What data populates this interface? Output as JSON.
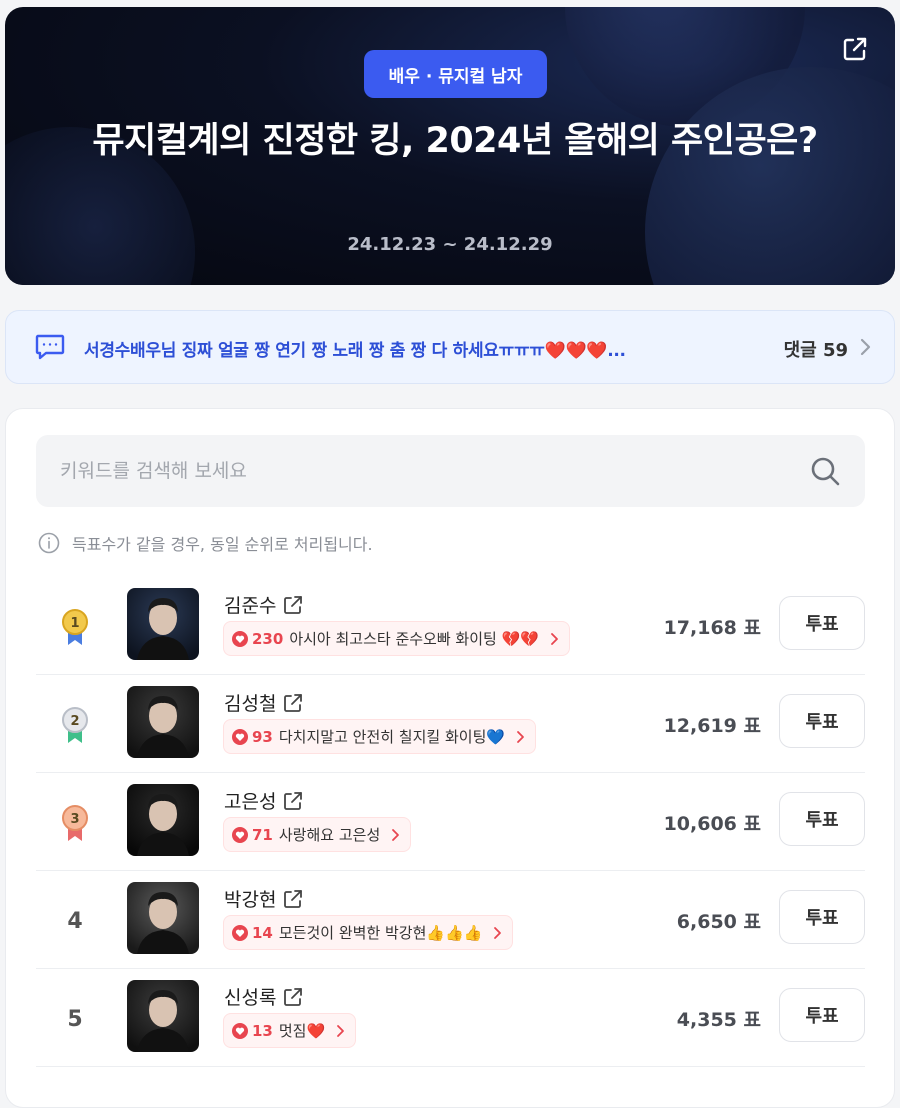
{
  "hero": {
    "category": "배우 · 뮤지컬 남자",
    "title": "뮤지컬계의 진정한 킹, 2024년 올해의 주인공은?",
    "period": "24.12.23 ~ 24.12.29"
  },
  "comment_bar": {
    "text": "서경수배우님 징짜 얼굴 짱 연기 짱 노래 짱 춤 짱 다 하세요ㅠㅠㅠ❤️❤️❤️...",
    "count_label": "댓글 59"
  },
  "search": {
    "placeholder": "키워드를 검색해 보세요"
  },
  "notice": "득표수가 같을 경우, 동일 순위로 처리됩니다.",
  "colors": {
    "accent": "#3b5bf0",
    "heart": "#e8454f",
    "gold": "#f2c94c",
    "silver": "#d5d8de",
    "bronze": "#f4a582"
  },
  "candidates": [
    {
      "rank": "1",
      "medal": "gold",
      "name": "김준수",
      "cheer_count": "230",
      "cheer_text": "아시아 최고스타 준수오빠 화이팅 💔💔",
      "votes": "17,168 표",
      "vote_label": "투표"
    },
    {
      "rank": "2",
      "medal": "silver",
      "name": "김성철",
      "cheer_count": "93",
      "cheer_text": "다치지말고 안전히 칠지킬 화이팅💙",
      "votes": "12,619 표",
      "vote_label": "투표"
    },
    {
      "rank": "3",
      "medal": "bronze",
      "name": "고은성",
      "cheer_count": "71",
      "cheer_text": "사랑해요 고은성",
      "votes": "10,606 표",
      "vote_label": "투표"
    },
    {
      "rank": "4",
      "medal": "",
      "name": "박강현",
      "cheer_count": "14",
      "cheer_text": "모든것이 완벽한 박강현👍👍👍",
      "votes": "6,650 표",
      "vote_label": "투표"
    },
    {
      "rank": "5",
      "medal": "",
      "name": "신성록",
      "cheer_count": "13",
      "cheer_text": "멋짐❤️",
      "votes": "4,355 표",
      "vote_label": "투표"
    }
  ]
}
